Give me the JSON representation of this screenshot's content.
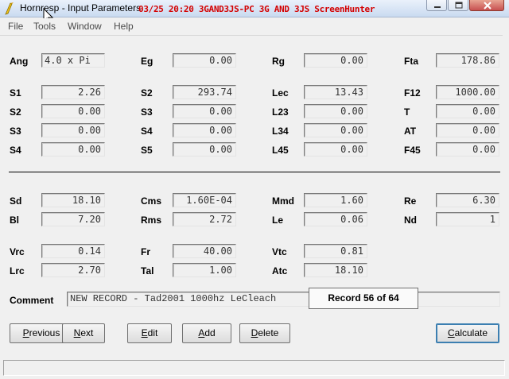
{
  "window": {
    "title": "Hornresp - Input Parameters",
    "overlay": "03/25  20:20  3GAND3JS-PC  3G AND 3JS  ScreenHunter"
  },
  "menu": [
    "File",
    "Tools",
    "Window",
    "Help"
  ],
  "rows": [
    [
      {
        "label": "Ang",
        "value": "4.0 x Pi"
      },
      {
        "label": "Eg",
        "value": "0.00"
      },
      {
        "label": "Rg",
        "value": "0.00"
      },
      {
        "label": "Fta",
        "value": "178.86"
      }
    ],
    [
      {
        "label": "S1",
        "value": "2.26"
      },
      {
        "label": "S2",
        "value": "293.74"
      },
      {
        "label": "Lec",
        "value": "13.43"
      },
      {
        "label": "F12",
        "value": "1000.00"
      }
    ],
    [
      {
        "label": "S2",
        "value": "0.00"
      },
      {
        "label": "S3",
        "value": "0.00"
      },
      {
        "label": "L23",
        "value": "0.00"
      },
      {
        "label": "T",
        "value": "0.00"
      }
    ],
    [
      {
        "label": "S3",
        "value": "0.00"
      },
      {
        "label": "S4",
        "value": "0.00"
      },
      {
        "label": "L34",
        "value": "0.00"
      },
      {
        "label": "AT",
        "value": "0.00"
      }
    ],
    [
      {
        "label": "S4",
        "value": "0.00"
      },
      {
        "label": "S5",
        "value": "0.00"
      },
      {
        "label": "L45",
        "value": "0.00"
      },
      {
        "label": "F45",
        "value": "0.00"
      }
    ],
    [
      {
        "label": "Sd",
        "value": "18.10"
      },
      {
        "label": "Cms",
        "value": "1.60E-04"
      },
      {
        "label": "Mmd",
        "value": "1.60"
      },
      {
        "label": "Re",
        "value": "6.30"
      }
    ],
    [
      {
        "label": "Bl",
        "value": "7.20"
      },
      {
        "label": "Rms",
        "value": "2.72"
      },
      {
        "label": "Le",
        "value": "0.06"
      },
      {
        "label": "Nd",
        "value": "1"
      }
    ],
    [
      {
        "label": "Vrc",
        "value": "0.14"
      },
      {
        "label": "Fr",
        "value": "40.00"
      },
      {
        "label": "Vtc",
        "value": "0.81"
      }
    ],
    [
      {
        "label": "Lrc",
        "value": "2.70"
      },
      {
        "label": "Tal",
        "value": "1.00"
      },
      {
        "label": "Atc",
        "value": "18.10"
      }
    ]
  ],
  "comment": {
    "label": "Comment",
    "value": "NEW RECORD - Tad2001 1000hz LeCleach"
  },
  "buttons": {
    "previous": {
      "ul": "P",
      "rest": "revious"
    },
    "next": {
      "ul": "N",
      "rest": "ext"
    },
    "edit": {
      "ul": "E",
      "rest": "dit"
    },
    "add": {
      "ul": "A",
      "rest": "dd"
    },
    "delete": {
      "ul": "D",
      "rest": "elete"
    },
    "calculate": {
      "ul": "C",
      "rest": "alculate"
    }
  },
  "record": "Record 56 of 64",
  "status": ""
}
